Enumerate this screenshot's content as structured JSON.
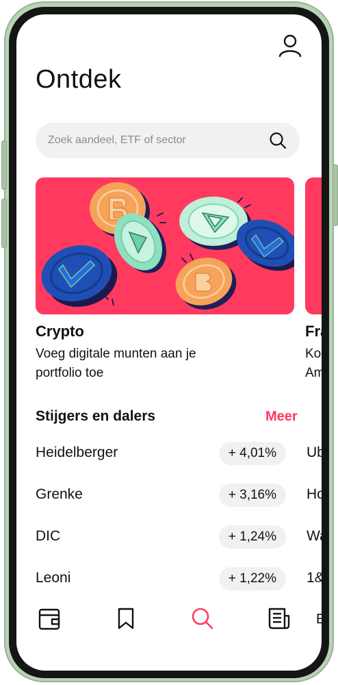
{
  "header": {
    "title": "Ontdek",
    "profile_icon": "user-icon"
  },
  "search": {
    "placeholder": "Zoek aandeel, ETF of sector",
    "value": "",
    "icon": "search-icon"
  },
  "cards": [
    {
      "title": "Crypto",
      "description_lines": [
        "Voeg digitale munten aan je",
        "portfolio toe"
      ],
      "image": "crypto-coins-illustration",
      "background": "#ff3a5e"
    },
    {
      "title": "Fra",
      "description_lines": [
        "Ko",
        "Am"
      ],
      "background": "#ff3a5e"
    }
  ],
  "movers": {
    "title": "Stijgers en dalers",
    "more_label": "Meer",
    "accent_color": "#ff3a5e",
    "rows": [
      {
        "name": "Heidelberger",
        "change": "+ 4,01%"
      },
      {
        "name": "Grenke",
        "change": "+ 3,16%"
      },
      {
        "name": "DIC",
        "change": "+ 1,24%"
      },
      {
        "name": "Leoni",
        "change": "+ 1,22%"
      }
    ],
    "next_column": [
      "Ub",
      "Ho",
      "Wa",
      "1&"
    ]
  },
  "nav": {
    "items": [
      {
        "icon": "wallet-icon",
        "active": false
      },
      {
        "icon": "bookmark-icon",
        "active": false
      },
      {
        "icon": "search-icon",
        "active": true
      },
      {
        "icon": "news-icon",
        "active": false
      }
    ],
    "peek_label": "E",
    "active_color": "#ff3a5e"
  },
  "frame_color": "#b9d3b6"
}
